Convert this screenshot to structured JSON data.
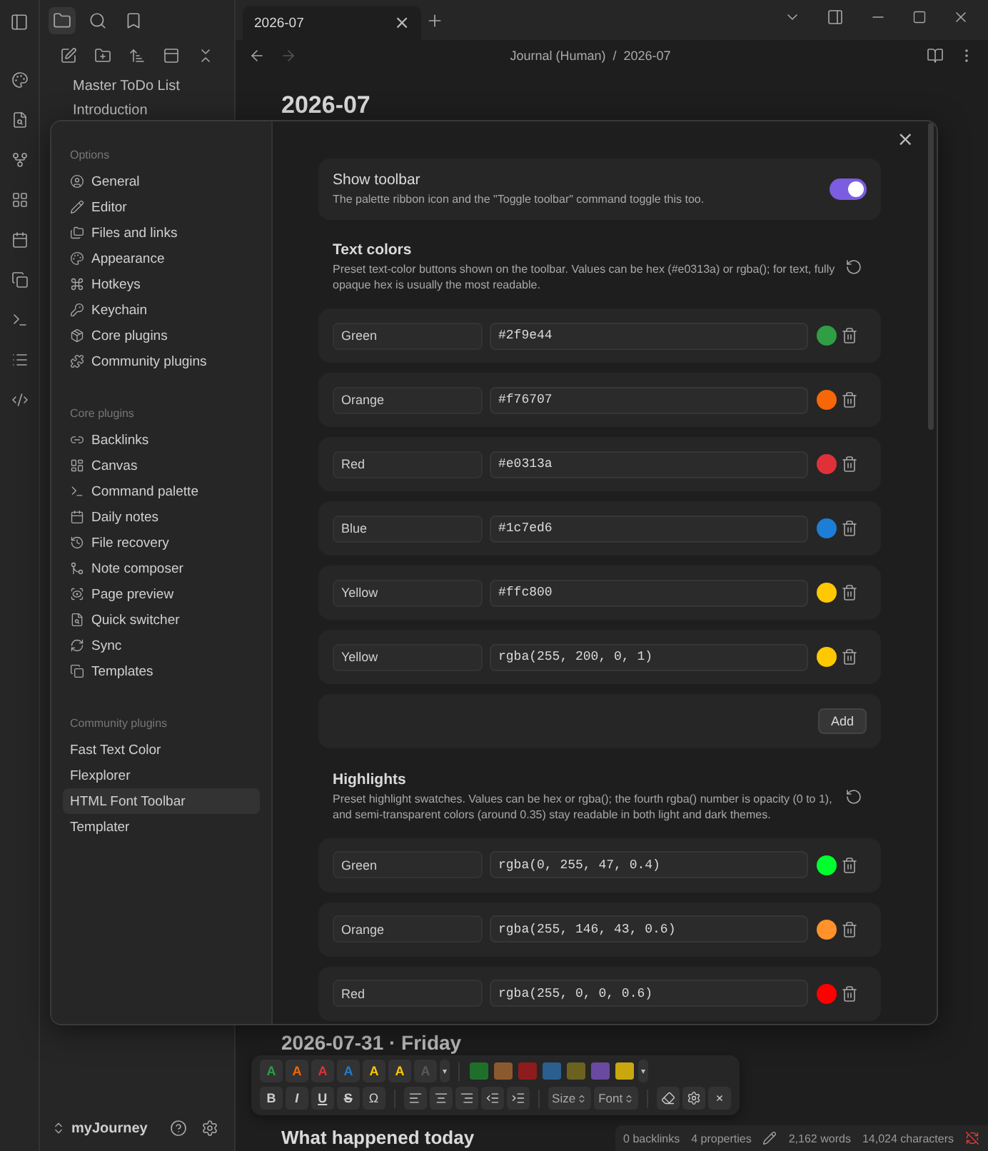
{
  "tabs": [
    {
      "label": "2026-07",
      "selected": true,
      "close": "×"
    }
  ],
  "breadcrumb": {
    "parts": [
      "Journal (Human)",
      "2026-07"
    ],
    "separator": "/"
  },
  "file_tree": {
    "items": [
      "Master ToDo List",
      "Introduction"
    ]
  },
  "vault": {
    "name": "myJourney"
  },
  "note": {
    "title": "2026-07",
    "day_heading": "2026-07-31 · Friday",
    "section_heading": "What happened today"
  },
  "settings": {
    "close": "×",
    "sections": [
      {
        "heading": "Options",
        "items": [
          {
            "label": "General",
            "selected": false
          },
          {
            "label": "Editor",
            "selected": false
          },
          {
            "label": "Files and links",
            "selected": false
          },
          {
            "label": "Appearance",
            "selected": false
          },
          {
            "label": "Hotkeys",
            "selected": false
          },
          {
            "label": "Keychain",
            "selected": false
          },
          {
            "label": "Core plugins",
            "selected": false
          },
          {
            "label": "Community plugins",
            "selected": false
          }
        ]
      },
      {
        "heading": "Core plugins",
        "items": [
          {
            "label": "Backlinks",
            "selected": false
          },
          {
            "label": "Canvas",
            "selected": false
          },
          {
            "label": "Command palette",
            "selected": false
          },
          {
            "label": "Daily notes",
            "selected": false
          },
          {
            "label": "File recovery",
            "selected": false
          },
          {
            "label": "Note composer",
            "selected": false
          },
          {
            "label": "Page preview",
            "selected": false
          },
          {
            "label": "Quick switcher",
            "selected": false
          },
          {
            "label": "Sync",
            "selected": false
          },
          {
            "label": "Templates",
            "selected": false
          }
        ]
      },
      {
        "heading": "Community plugins",
        "items": [
          {
            "label": "Fast Text Color",
            "selected": false
          },
          {
            "label": "Flexplorer",
            "selected": false
          },
          {
            "label": "HTML Font Toolbar",
            "selected": true
          },
          {
            "label": "Templater",
            "selected": false
          }
        ]
      }
    ],
    "show_toolbar": {
      "title": "Show toolbar",
      "description": "The palette ribbon icon and the \"Toggle toolbar\" command toggle this too.",
      "on": true
    },
    "text_colors": {
      "title": "Text colors",
      "description": "Preset text-color buttons shown on the toolbar. Values can be hex (#e0313a) or rgba(); for text, fully opaque hex is usually the most readable.",
      "add_button": "Add",
      "rows": [
        {
          "name": "Green",
          "value": "#2f9e44",
          "color": "#2f9e44"
        },
        {
          "name": "Orange",
          "value": "#f76707",
          "color": "#f76707"
        },
        {
          "name": "Red",
          "value": "#e0313a",
          "color": "#e0313a"
        },
        {
          "name": "Blue",
          "value": "#1c7ed6",
          "color": "#1c7ed6"
        },
        {
          "name": "Yellow",
          "value": "#ffc800",
          "color": "#ffc800"
        },
        {
          "name": "Yellow",
          "value": "rgba(255, 200, 0, 1)",
          "color": "#ffc800"
        }
      ]
    },
    "highlights": {
      "title": "Highlights",
      "description": "Preset highlight swatches. Values can be hex or rgba(); the fourth rgba() number is opacity (0 to 1), and semi-transparent colors (around 0.35) stay readable in both light and dark themes.",
      "rows": [
        {
          "name": "Green",
          "value": "rgba(0, 255, 47, 0.4)",
          "color": "#00ff2f"
        },
        {
          "name": "Orange",
          "value": "rgba(255, 146, 43, 0.6)",
          "color": "#ff922b"
        },
        {
          "name": "Red",
          "value": "rgba(255, 0, 0, 0.6)",
          "color": "#ff0000"
        }
      ]
    }
  },
  "format_toolbar": {
    "text_colors": [
      {
        "label": "A",
        "color": "#2f9e44"
      },
      {
        "label": "A",
        "color": "#f76707"
      },
      {
        "label": "A",
        "color": "#e0313a"
      },
      {
        "label": "A",
        "color": "#1c7ed6"
      },
      {
        "label": "A",
        "color": "#ffc800"
      },
      {
        "label": "A",
        "color": "#ffc800"
      },
      {
        "label": "A",
        "color": "#5a5a5a"
      }
    ],
    "text_more": "▾",
    "highlights": [
      {
        "color": "#1f6f2b"
      },
      {
        "color": "#8a5a2e"
      },
      {
        "color": "#8e1c1c"
      },
      {
        "color": "#2a5f8f"
      },
      {
        "color": "#6b6220"
      },
      {
        "color": "#6a4aa0"
      },
      {
        "color": "#c9a70e"
      }
    ],
    "highlight_more": "▾",
    "styles": [
      {
        "label": "B",
        "kind": "bold"
      },
      {
        "label": "I",
        "kind": "italic"
      },
      {
        "label": "U",
        "kind": "underline"
      },
      {
        "label": "S",
        "kind": "strike"
      },
      {
        "label": "Ω",
        "kind": "plain"
      }
    ],
    "selects": [
      "Size",
      "Font"
    ],
    "close": "×"
  },
  "status_bar": {
    "backlinks": "0 backlinks",
    "properties": "4 properties",
    "words": "2,162 words",
    "characters": "14,024 characters"
  }
}
